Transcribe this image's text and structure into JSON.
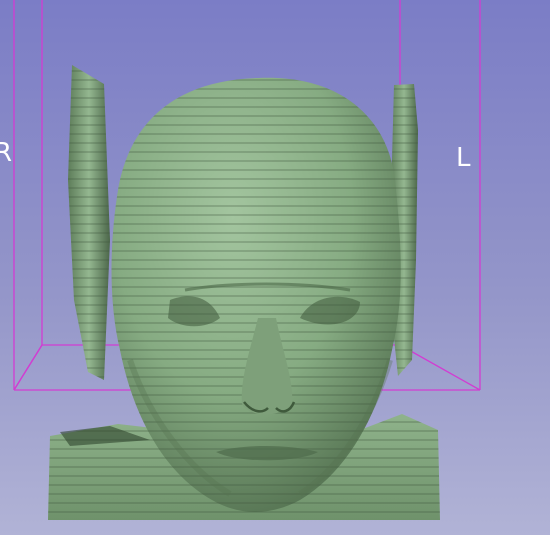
{
  "viewer": {
    "orientation": {
      "right_label": "R",
      "left_label": "L"
    },
    "colors": {
      "background_top": "#7b7dc6",
      "background_bottom": "#b1b3d6",
      "bounding_box": "#d23cd2",
      "model": "#87ac84"
    }
  }
}
